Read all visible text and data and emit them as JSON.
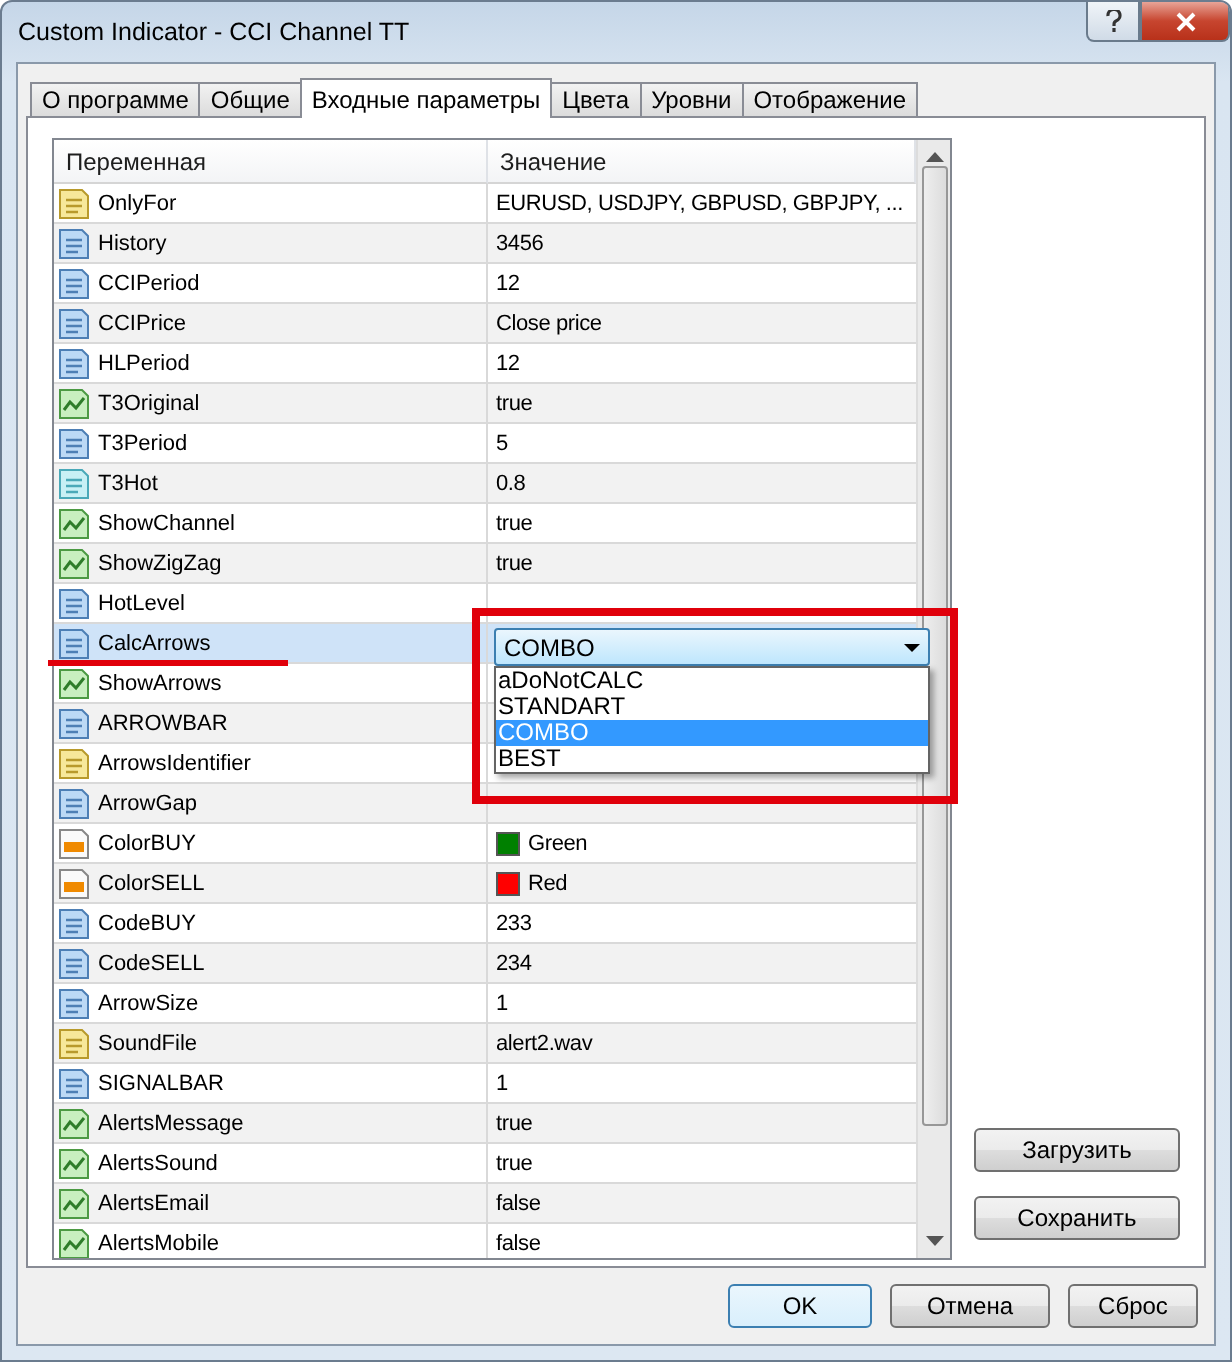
{
  "window": {
    "title": "Custom Indicator - CCI Channel TT"
  },
  "tabs": [
    {
      "label": "О программе",
      "selected": false
    },
    {
      "label": "Общие",
      "selected": false
    },
    {
      "label": "Входные параметры",
      "selected": true
    },
    {
      "label": "Цвета",
      "selected": false
    },
    {
      "label": "Уровни",
      "selected": false
    },
    {
      "label": "Отображение",
      "selected": false
    }
  ],
  "table": {
    "columns": [
      "Переменная",
      "Значение"
    ],
    "rows": [
      {
        "kind": "string",
        "name": "OnlyFor",
        "value": "EURUSD, USDJPY, GBPUSD, GBPJPY, ...",
        "selected": false
      },
      {
        "kind": "int",
        "name": "History",
        "value": "3456",
        "selected": false
      },
      {
        "kind": "int",
        "name": "CCIPeriod",
        "value": "12",
        "selected": false
      },
      {
        "kind": "int",
        "name": "CCIPrice",
        "value": "Close price",
        "selected": false
      },
      {
        "kind": "int",
        "name": "HLPeriod",
        "value": "12",
        "selected": false
      },
      {
        "kind": "bool",
        "name": "T3Original",
        "value": "true",
        "selected": false
      },
      {
        "kind": "int",
        "name": "T3Period",
        "value": "5",
        "selected": false
      },
      {
        "kind": "double",
        "name": "T3Hot",
        "value": "0.8",
        "selected": false
      },
      {
        "kind": "bool",
        "name": "ShowChannel",
        "value": "true",
        "selected": false
      },
      {
        "kind": "bool",
        "name": "ShowZigZag",
        "value": "true",
        "selected": false
      },
      {
        "kind": "int",
        "name": "HotLevel",
        "selected": false
      },
      {
        "kind": "int",
        "name": "CalcArrows",
        "selected": true
      },
      {
        "kind": "bool",
        "name": "ShowArrows",
        "selected": false
      },
      {
        "kind": "int",
        "name": "ARROWBAR",
        "selected": false
      },
      {
        "kind": "string",
        "name": "ArrowsIdentifier",
        "selected": false
      },
      {
        "kind": "int",
        "name": "ArrowGap",
        "selected": false
      },
      {
        "kind": "color",
        "name": "ColorBUY",
        "value": "Green",
        "color": "#008000",
        "selected": false
      },
      {
        "kind": "color",
        "name": "ColorSELL",
        "value": "Red",
        "color": "#ff0000",
        "selected": false
      },
      {
        "kind": "int",
        "name": "CodeBUY",
        "value": "233",
        "selected": false
      },
      {
        "kind": "int",
        "name": "CodeSELL",
        "value": "234",
        "selected": false
      },
      {
        "kind": "int",
        "name": "ArrowSize",
        "value": "1",
        "selected": false
      },
      {
        "kind": "string",
        "name": "SoundFile",
        "value": "alert2.wav",
        "selected": false
      },
      {
        "kind": "int",
        "name": "SIGNALBAR",
        "value": "1",
        "selected": false
      },
      {
        "kind": "bool",
        "name": "AlertsMessage",
        "value": "true",
        "selected": false
      },
      {
        "kind": "bool",
        "name": "AlertsSound",
        "value": "true",
        "selected": false
      },
      {
        "kind": "bool",
        "name": "AlertsEmail",
        "value": "false",
        "selected": false
      },
      {
        "kind": "bool",
        "name": "AlertsMobile",
        "value": "false",
        "selected": false
      }
    ]
  },
  "dropdown": {
    "value": "COMBO",
    "expanded": true,
    "options": [
      {
        "label": "aDoNotCALC",
        "selected": false
      },
      {
        "label": "STANDART",
        "selected": false
      },
      {
        "label": "COMBO",
        "selected": true
      },
      {
        "label": "BEST",
        "selected": false
      }
    ]
  },
  "side_buttons": [
    "Загрузить",
    "Сохранить"
  ],
  "buttons": [
    {
      "label": "OK",
      "default": true
    },
    {
      "label": "Отмена",
      "default": false
    },
    {
      "label": "Сброс",
      "default": false
    }
  ]
}
